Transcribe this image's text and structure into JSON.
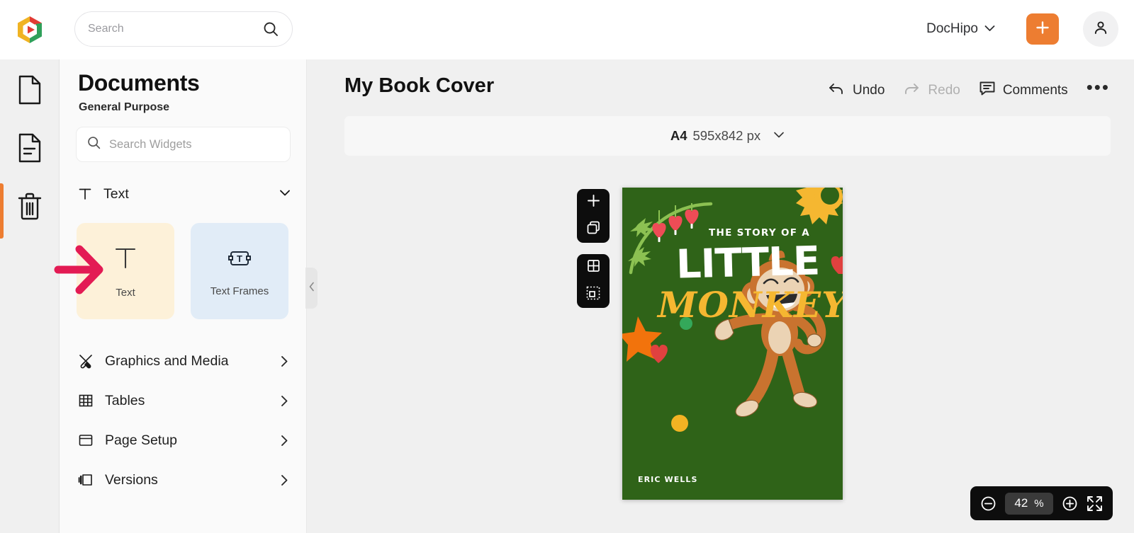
{
  "topbar": {
    "logo_icon": "dochipo-logo-icon",
    "search": {
      "placeholder": "Search",
      "value": "",
      "icon": "search-icon"
    },
    "workspace": {
      "label": "DocHipo",
      "chevron_icon": "chevron-down-icon"
    },
    "create_button": {
      "icon": "plus-icon",
      "color": "#ED7D31"
    },
    "account_button": {
      "icon": "user-icon"
    }
  },
  "rail": {
    "items": [
      {
        "icon": "page-icon",
        "name": "blank-page",
        "active": false
      },
      {
        "icon": "document-lines-icon",
        "name": "documents",
        "active": true
      },
      {
        "icon": "trash-icon",
        "name": "trash",
        "active": false
      }
    ],
    "active_color": "#ED7D31"
  },
  "panel": {
    "title": "Documents",
    "subtitle": "General Purpose",
    "search": {
      "placeholder": "Search Widgets",
      "value": "",
      "icon": "search-icon"
    },
    "section": {
      "label": "Text",
      "icon": "text-t-icon",
      "chevron_icon": "chevron-down-icon",
      "expanded": true
    },
    "widgets": [
      {
        "label": "Text",
        "icon": "text-t-icon",
        "bg": "#FDF1D9"
      },
      {
        "label": "Text Frames",
        "icon": "text-frame-icon",
        "bg": "#E1ECF7"
      }
    ],
    "menu": [
      {
        "label": "Graphics and Media",
        "icon": "graphics-media-icon",
        "chevron_icon": "chevron-right-icon"
      },
      {
        "label": "Tables",
        "icon": "table-grid-icon",
        "chevron_icon": "chevron-right-icon"
      },
      {
        "label": "Page Setup",
        "icon": "page-setup-icon",
        "chevron_icon": "chevron-right-icon"
      },
      {
        "label": "Versions",
        "icon": "versions-icon",
        "chevron_icon": "chevron-right-icon"
      }
    ],
    "collapse_handle_icon": "chevron-left-icon"
  },
  "annotation": {
    "arrow_color": "#E31B54",
    "points_to": "Text widget card"
  },
  "editor": {
    "doc_title": "My Book Cover",
    "actions": [
      {
        "label": "Undo",
        "icon": "undo-arrow-icon",
        "disabled": false
      },
      {
        "label": "Redo",
        "icon": "redo-arrow-icon",
        "disabled": true
      },
      {
        "label": "Comments",
        "icon": "comment-bubble-icon",
        "disabled": false
      }
    ],
    "more_label": "•••",
    "page_size": {
      "name": "A4",
      "dimensions": "595x842 px",
      "chevron_icon": "chevron-down-icon"
    },
    "page_tools": [
      {
        "icon": "plus-icon",
        "name": "add-page"
      },
      {
        "icon": "duplicate-squares-icon",
        "name": "duplicate-page"
      },
      {
        "icon": "grid-icon",
        "name": "grid-view"
      },
      {
        "icon": "select-area-icon",
        "name": "select-area"
      }
    ],
    "zoom": {
      "value": "42",
      "unit": "%",
      "minus_icon": "minus-circle-icon",
      "plus_icon": "plus-circle-icon",
      "fullscreen_icon": "fullscreen-expand-icon"
    }
  },
  "cover": {
    "background": "#2F6318",
    "line1": "THE STORY OF A",
    "title": "LITTLE",
    "subtitle": "MONKEY",
    "subtitle_color": "#F5B731",
    "author": "ERIC WELLS",
    "decorations": [
      "vine-with-leaves",
      "hanging-hearts",
      "sun",
      "orange-star",
      "green-dot",
      "red-heart",
      "yellow-dot",
      "monkey-illustration"
    ]
  }
}
